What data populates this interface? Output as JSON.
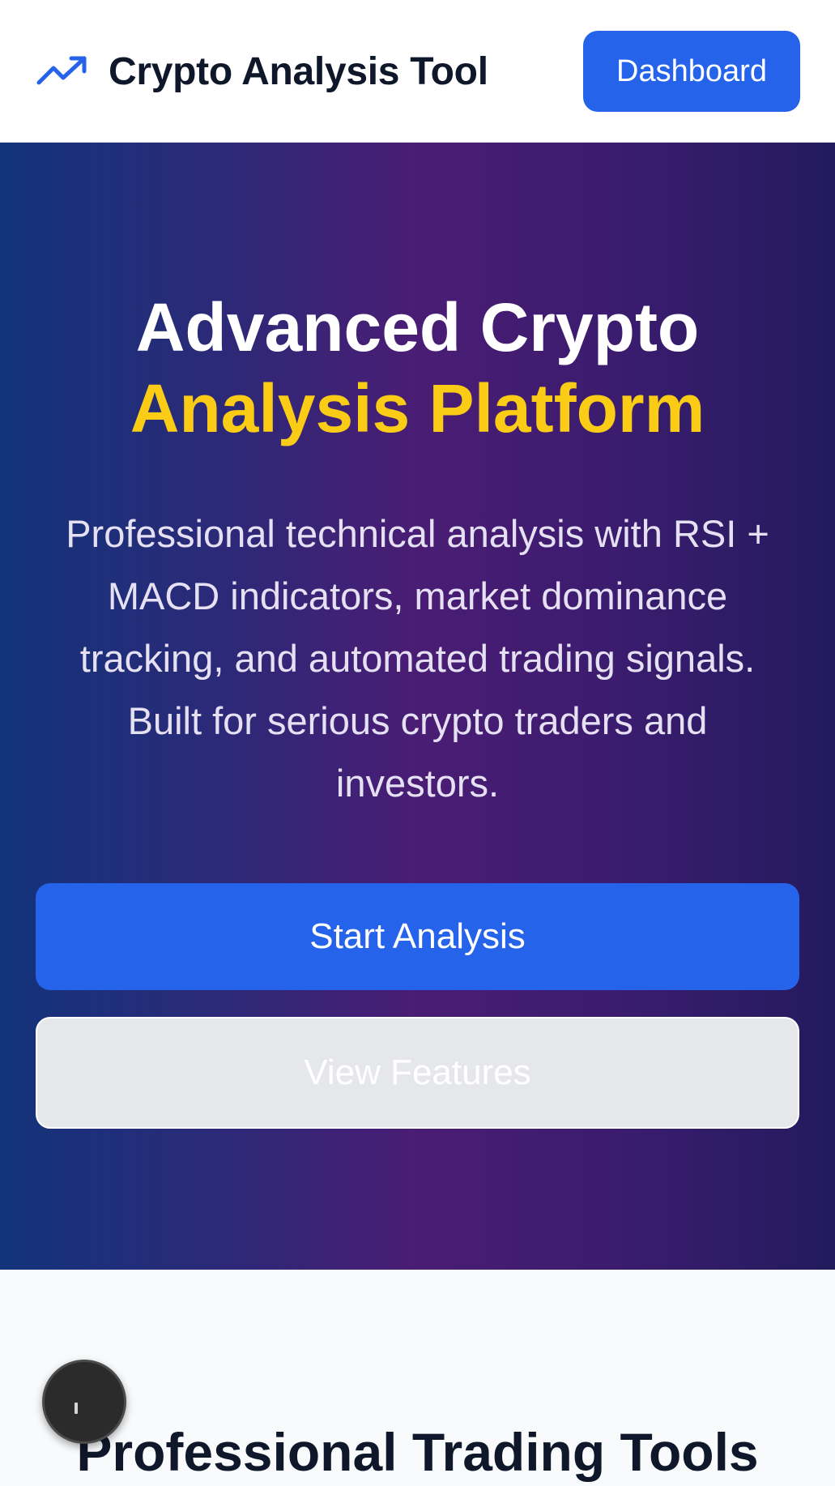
{
  "header": {
    "brand_icon": "trending-up-icon",
    "title": "Crypto Analysis Tool",
    "dashboard_label": "Dashboard"
  },
  "hero": {
    "title_line1": "Advanced Crypto",
    "title_line2": "Analysis Platform",
    "description": "Professional technical analysis with RSI + MACD indicators, market dominance tracking, and automated trading signals. Built for serious crypto traders and investors.",
    "primary_cta": "Start Analysis",
    "secondary_cta": "View Features"
  },
  "features": {
    "heading": "Professional Trading Tools"
  },
  "floating_button": {
    "icon": "floating-action-icon"
  },
  "colors": {
    "accent": "#2563eb",
    "highlight": "#facc15",
    "text_dark": "#0f172a",
    "hero_gradient_start": "#13347a",
    "hero_gradient_mid": "#4a1d74",
    "hero_gradient_end": "#231b5e"
  }
}
